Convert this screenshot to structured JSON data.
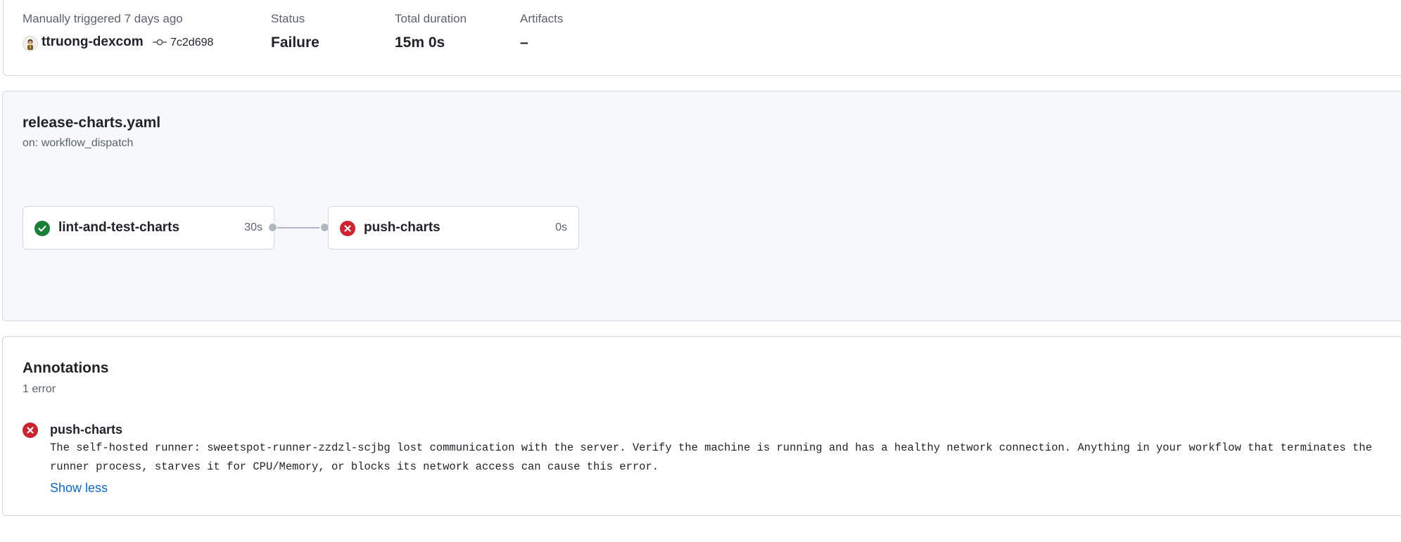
{
  "summary": {
    "trigger_text": "Manually triggered 7 days ago",
    "actor": "ttruong-dexcom",
    "commit_sha": "7c2d698",
    "status_label": "Status",
    "status_value": "Failure",
    "duration_label": "Total duration",
    "duration_value": "15m 0s",
    "artifacts_label": "Artifacts",
    "artifacts_value": "–"
  },
  "workflow": {
    "file_name": "release-charts.yaml",
    "trigger": "on: workflow_dispatch",
    "jobs": [
      {
        "name": "lint-and-test-charts",
        "duration": "30s",
        "status": "success"
      },
      {
        "name": "push-charts",
        "duration": "0s",
        "status": "failure"
      }
    ]
  },
  "annotations": {
    "title": "Annotations",
    "count_text": "1 error",
    "items": [
      {
        "job": "push-charts",
        "message": "The self-hosted runner: sweetspot-runner-zzdzl-scjbg lost communication with the server. Verify the machine is running and has a healthy network connection. Anything in your workflow that terminates the runner process, starves it for CPU/Memory, or blocks its network access can cause this error.",
        "toggle_label": "Show less"
      }
    ]
  },
  "icons": {
    "success": "check-circle-icon",
    "failure": "x-circle-icon",
    "commit": "git-commit-icon",
    "fullscreen": "fullscreen-icon",
    "zoom_out": "minus-icon",
    "zoom_in": "plus-icon"
  },
  "colors": {
    "success": "#1a7f37",
    "failure": "#cf222e",
    "link": "#0969da",
    "muted": "#59636e"
  }
}
